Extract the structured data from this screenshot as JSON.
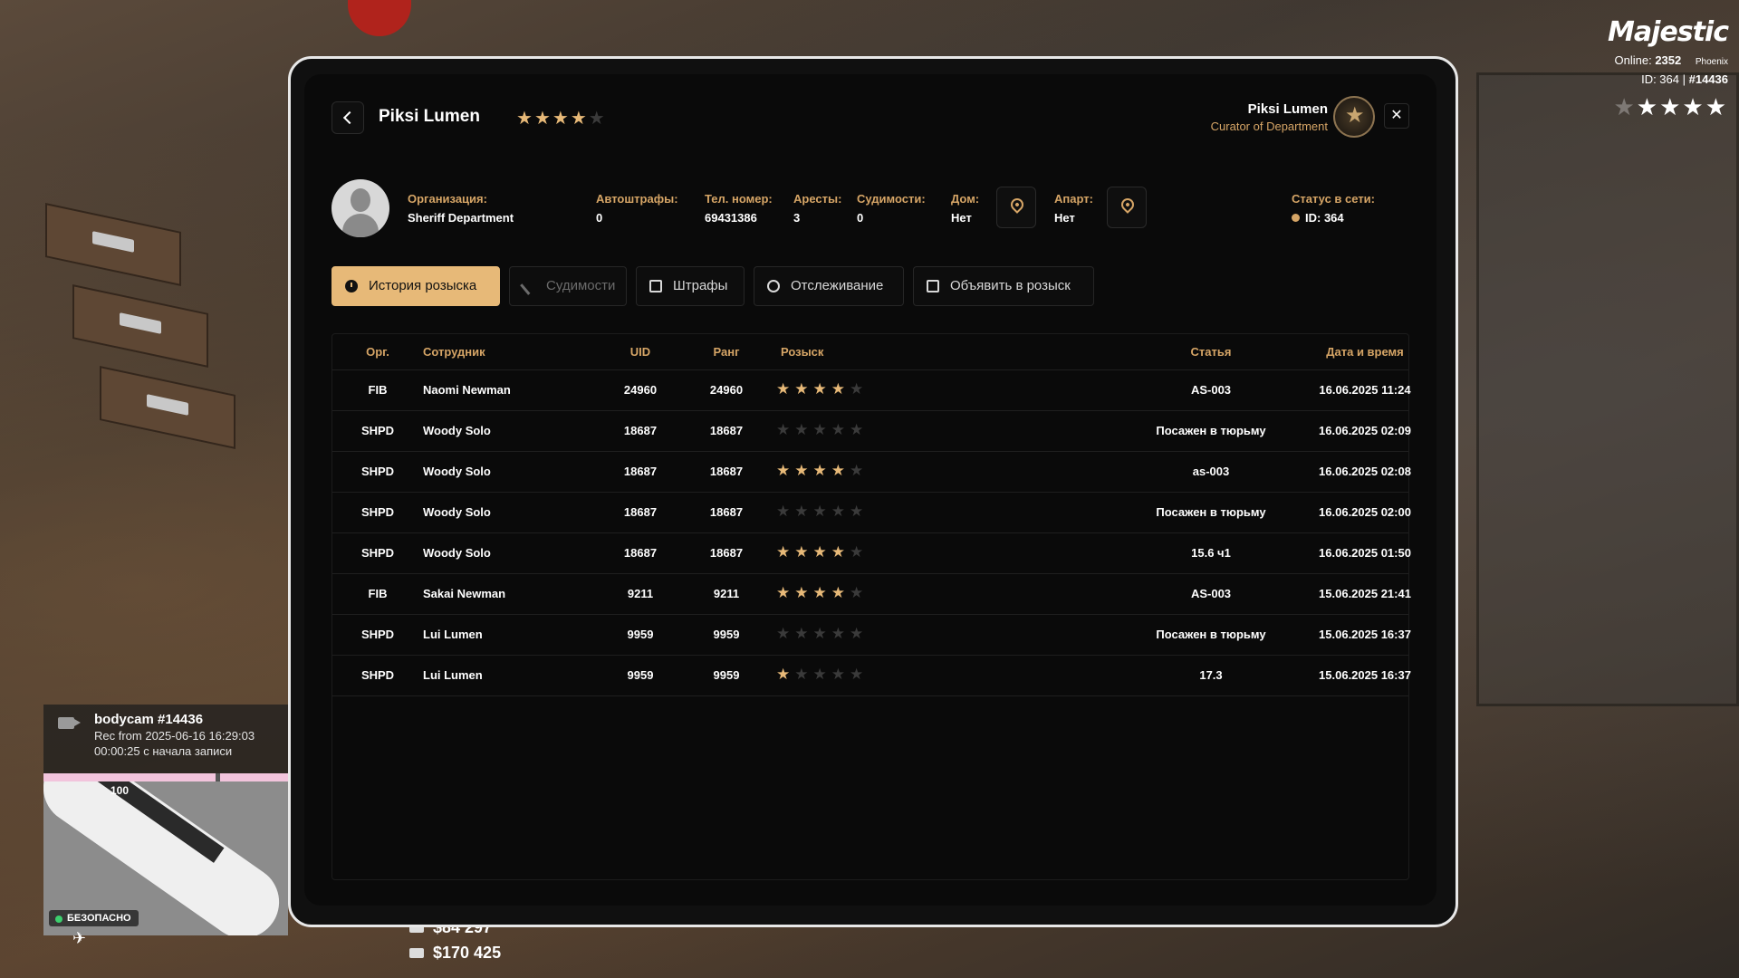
{
  "hud": {
    "logo": "Majestic",
    "online_label": "Online:",
    "online_value": "2352",
    "server": "Phoenix",
    "id_text": "ID: 364 |",
    "id_hash": "#14436",
    "wanted_stars_active": 4,
    "wanted_stars_total": 5
  },
  "bodycam": {
    "title": "bodycam #14436",
    "rec_line": "Rec from 2025-06-16 16:29:03",
    "elapsed_line": "00:00:25 с начала записи"
  },
  "minimap": {
    "label_100": "100",
    "safe_label": "БЕЗОПАСНО"
  },
  "money": {
    "cash": "$84 297",
    "bank": "$170 425"
  },
  "header": {
    "title": "Piksi Lumen",
    "title_stars_active": 4,
    "user_name": "Piksi Lumen",
    "user_role": "Curator of Department",
    "close": "✕"
  },
  "profile": {
    "org_label": "Организация:",
    "org_value": "Sheriff Department",
    "fines_label": "Автоштрафы:",
    "fines_value": "0",
    "phone_label": "Тел. номер:",
    "phone_value": "69431386",
    "arrests_label": "Аресты:",
    "arrests_value": "3",
    "convictions_label": "Судимости:",
    "convictions_value": "0",
    "house_label": "Дом:",
    "house_value": "Нет",
    "apart_label": "Апарт:",
    "apart_value": "Нет",
    "status_label": "Статус в сети:",
    "status_value": "ID: 364"
  },
  "tabs": [
    {
      "label": "История розыска",
      "icon": "clock-icon",
      "state": "active"
    },
    {
      "label": "Судимости",
      "icon": "gavel-icon",
      "state": "disabled"
    },
    {
      "label": "Штрафы",
      "icon": "document-icon",
      "state": "normal"
    },
    {
      "label": "Отслеживание",
      "icon": "person-icon",
      "state": "normal"
    },
    {
      "label": "Объявить в розыск",
      "icon": "search-icon",
      "state": "normal"
    }
  ],
  "table": {
    "headers": {
      "org": "Орг.",
      "employee": "Сотрудник",
      "uid": "UID",
      "rank": "Ранг",
      "wanted": "Розыск",
      "article": "Статья",
      "datetime": "Дата и время"
    },
    "rows": [
      {
        "org": "FIB",
        "employee": "Naomi Newman",
        "uid": "24960",
        "rank": "24960",
        "stars": 4,
        "article": "AS-003",
        "datetime": "16.06.2025 11:24"
      },
      {
        "org": "SHPD",
        "employee": "Woody Solo",
        "uid": "18687",
        "rank": "18687",
        "stars": 0,
        "article": "Посажен в тюрьму",
        "datetime": "16.06.2025 02:09"
      },
      {
        "org": "SHPD",
        "employee": "Woody Solo",
        "uid": "18687",
        "rank": "18687",
        "stars": 4,
        "article": "as-003",
        "datetime": "16.06.2025 02:08"
      },
      {
        "org": "SHPD",
        "employee": "Woody Solo",
        "uid": "18687",
        "rank": "18687",
        "stars": 0,
        "article": "Посажен в тюрьму",
        "datetime": "16.06.2025 02:00"
      },
      {
        "org": "SHPD",
        "employee": "Woody Solo",
        "uid": "18687",
        "rank": "18687",
        "stars": 4,
        "article": "15.6 ч1",
        "datetime": "16.06.2025 01:50"
      },
      {
        "org": "FIB",
        "employee": "Sakai Newman",
        "uid": "9211",
        "rank": "9211",
        "stars": 4,
        "article": "AS-003",
        "datetime": "15.06.2025 21:41"
      },
      {
        "org": "SHPD",
        "employee": "Lui Lumen",
        "uid": "9959",
        "rank": "9959",
        "stars": 0,
        "article": "Посажен в тюрьму",
        "datetime": "15.06.2025 16:37"
      },
      {
        "org": "SHPD",
        "employee": "Lui Lumen",
        "uid": "9959",
        "rank": "9959",
        "stars": 1,
        "article": "17.3",
        "datetime": "15.06.2025 16:37"
      }
    ]
  },
  "colors": {
    "accent": "#e7b978",
    "label_gold": "#d6a566",
    "panel_bg": "#0a0a0a",
    "star_off": "#3a3a3a"
  }
}
